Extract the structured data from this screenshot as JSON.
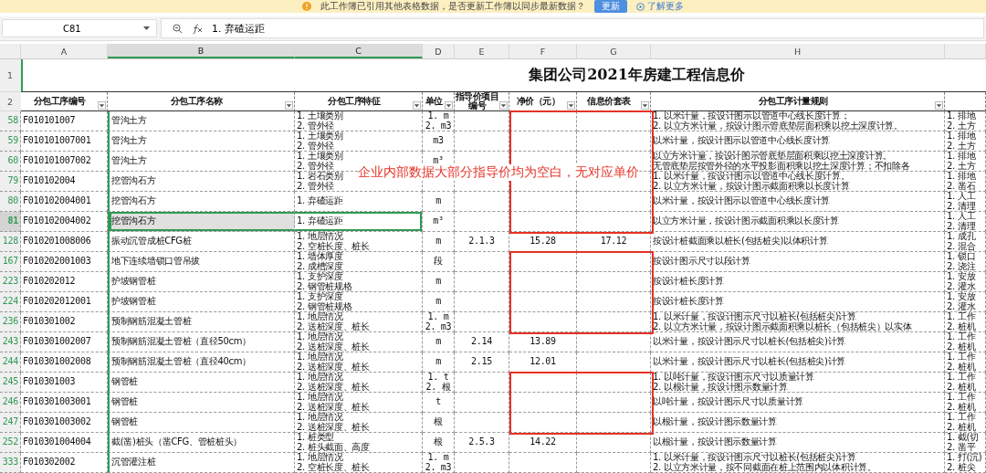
{
  "notification": {
    "message": "此工作簿已引用其他表格数据，是否更新工作簿以同步最新数据？",
    "button": "更新",
    "link": "了解更多"
  },
  "formula_bar": {
    "cell_ref": "C81",
    "formula": "1. 弃碴运距"
  },
  "columns": [
    {
      "label": "A",
      "selected": false
    },
    {
      "label": "B",
      "selected": true
    },
    {
      "label": "C",
      "selected": true
    },
    {
      "label": "D",
      "selected": false
    },
    {
      "label": "E",
      "selected": false
    },
    {
      "label": "F",
      "selected": false
    },
    {
      "label": "G",
      "selected": false
    },
    {
      "label": "H",
      "selected": false
    }
  ],
  "title_row": {
    "row": "1",
    "title": "集团公司2021年房建工程信息价"
  },
  "header_row": {
    "row": "2",
    "headers": [
      "分包工序编号",
      "分包工序名称",
      "分包工序特征",
      "单位",
      "指导价项目编号",
      "净价（元）",
      "信息价套表",
      "分包工序计量规则"
    ]
  },
  "rows": [
    {
      "row": "58",
      "code": "F010101007",
      "name": "管沟土方",
      "features": [
        "1. 土壤类别",
        "2. 管外径"
      ],
      "unit": [
        "1. m",
        "2. m3"
      ],
      "rules": [
        "1. 以米计量，按设计图示以管道中心线长度计算；",
        "2. 以立方米计量，按设计图示管底垫层面积乘以挖土深度计算。"
      ],
      "column_9": [
        "1. 排地",
        "2. 土方"
      ],
      "flagged": true,
      "selected": false
    },
    {
      "row": "59",
      "code": "F010101007001",
      "name": "管沟土方",
      "features": [
        "1. 土壤类别",
        "2. 管外径"
      ],
      "unit": [
        "m3"
      ],
      "rules": [
        "以米计量，按设计图示以管道中心线长度计算"
      ],
      "column_9": [
        "1. 排地",
        "2. 土方"
      ],
      "flagged": true,
      "selected": false
    },
    {
      "row": "60",
      "code": "F010101007002",
      "name": "管沟土方",
      "features": [
        "1. 土壤类别",
        "2. 管外径"
      ],
      "unit": [
        "m³"
      ],
      "rules": [
        "以立方米计量，按设计图示管底垫层面积乘以挖土深度计算。",
        "无管底垫层按管外径的水平投影面积乘以挖土深度计算；不扣除各"
      ],
      "column_9": [
        "1. 排地",
        "2. 土方"
      ],
      "flagged": true,
      "selected": false
    },
    {
      "row": "79",
      "code": "F010102004",
      "name": "挖管沟石方",
      "features": [
        "1. 岩石类别",
        "2. 管外径"
      ],
      "rules": [
        "1. 以米计量，按设计图示以管道中心线长度计算。",
        "2. 以立方米计量，按设计图示截面积乘以长度计算"
      ],
      "column_9": [
        "1. 排地",
        "2. 凿石"
      ],
      "flagged": true,
      "selected": false
    },
    {
      "row": "80",
      "code": "F010102004001",
      "name": "挖管沟石方",
      "features": [
        "1. 弃碴运距"
      ],
      "unit": [
        "m"
      ],
      "rules": [
        "以米计量，按设计图示以管道中心线长度计算"
      ],
      "column_9": [
        "1. 人工",
        "2. 清理"
      ],
      "flagged": true,
      "selected": false
    },
    {
      "row": "81",
      "code": "F010102004002",
      "name": "挖管沟石方",
      "features": [
        "1. 弃碴运距"
      ],
      "unit": [
        "m³"
      ],
      "rules": [
        "以立方米计量，按设计图示截面积乘以长度计算"
      ],
      "column_9": [
        "1. 人工",
        "2. 清理"
      ],
      "flagged": true,
      "selected": true
    },
    {
      "row": "128",
      "code": "F010201008006",
      "name": "振动沉管成桩CFG桩",
      "features": [
        "1. 地层情况",
        "2. 空桩长度、桩长"
      ],
      "unit": [
        "m"
      ],
      "guide_code": "2.1.3",
      "net_price": "15.28",
      "info_price": "17.12",
      "rules": [
        "按设计桩截面乘以桩长(包括桩尖)以体积计算"
      ],
      "column_9": [
        "1. 成孔",
        "2. 混合"
      ],
      "flagged": false,
      "selected": false
    },
    {
      "row": "167",
      "code": "F010202001003",
      "name": "地下连续墙锁口管吊拔",
      "features": [
        "1. 墙体厚度",
        "2. 成槽深度"
      ],
      "unit": [
        "段"
      ],
      "rules": [
        "按设计图示尺寸以段计算"
      ],
      "column_9": [
        "1. 锁口",
        "2. 浇注"
      ],
      "flagged": true,
      "selected": false
    },
    {
      "row": "223",
      "code": "F010202012",
      "name": "护坡钢管桩",
      "features": [
        "1. 支护深度",
        "2. 钢管桩规格"
      ],
      "unit": [
        "m"
      ],
      "rules": [
        "按设计桩长度计算"
      ],
      "column_9": [
        "1. 安放",
        "2. 灌水"
      ],
      "flagged": true,
      "selected": false
    },
    {
      "row": "224",
      "code": "F010202012001",
      "name": "护坡钢管桩",
      "features": [
        "1. 支护深度",
        "2. 钢管桩规格"
      ],
      "unit": [
        "m"
      ],
      "rules": [
        "按设计桩长度计算"
      ],
      "column_9": [
        "1. 安放",
        "2. 灌水"
      ],
      "flagged": true,
      "selected": false
    },
    {
      "row": "236",
      "code": "F010301002",
      "name": "预制钢筋混凝土管桩",
      "features": [
        "1. 地层情况",
        "2. 送桩深度、桩长"
      ],
      "unit": [
        "1. m",
        "2. m3"
      ],
      "rules": [
        "1. 以米计量，按设计图示尺寸以桩长(包括桩尖)计算",
        "2. 以立方米计量，按设计图示截面积乘以桩长（包括桩尖）以实体"
      ],
      "column_9": [
        "1. 工作",
        "2. 桩机"
      ],
      "flagged": true,
      "selected": false
    },
    {
      "row": "243",
      "code": "F010301002007",
      "name": "预制钢筋混凝土管桩（直径50cm）",
      "features": [
        "1. 地层情况",
        "2. 送桩深度、桩长"
      ],
      "unit": [
        "m"
      ],
      "guide_code": "2.14",
      "net_price": "13.89",
      "rules": [
        "以米计量，按设计图示尺寸以桩长(包括桩尖)计算"
      ],
      "column_9": [
        "1. 工作",
        "2. 桩机"
      ],
      "flagged": false,
      "selected": false
    },
    {
      "row": "244",
      "code": "F010301002008",
      "name": "预制钢筋混凝土管桩（直径40cm）",
      "features": [
        "1. 地层情况",
        "2. 送桩深度、桩长"
      ],
      "unit": [
        "m"
      ],
      "guide_code": "2.15",
      "net_price": "12.01",
      "rules": [
        "以米计量，按设计图示尺寸以桩长(包括桩尖)计算"
      ],
      "column_9": [
        "1. 工作",
        "2. 桩机"
      ],
      "flagged": false,
      "selected": false
    },
    {
      "row": "245",
      "code": "F010301003",
      "name": "钢管桩",
      "features": [
        "1. 地层情况",
        "2. 送桩深度、桩长"
      ],
      "unit": [
        "1. t",
        "2. 根"
      ],
      "rules": [
        "1. 以吨计量，按设计图示尺寸以质量计算",
        "2. 以根计量，按设计图示数量计算"
      ],
      "column_9": [
        "1. 工作",
        "2. 桩机"
      ],
      "flagged": true,
      "selected": false
    },
    {
      "row": "246",
      "code": "F010301003001",
      "name": "钢管桩",
      "features": [
        "1. 地层情况",
        "2. 送桩深度、桩长"
      ],
      "unit": [
        "t"
      ],
      "rules": [
        "以吨计量，按设计图示尺寸以质量计算"
      ],
      "column_9": [
        "1. 工作",
        "2. 桩机"
      ],
      "flagged": true,
      "selected": false
    },
    {
      "row": "247",
      "code": "F010301003002",
      "name": "钢管桩",
      "features": [
        "1. 地层情况",
        "2. 送桩深度、桩长"
      ],
      "unit": [
        "根"
      ],
      "rules": [
        "以根计量，按设计图示数量计算"
      ],
      "column_9": [
        "1. 工作",
        "2. 桩机"
      ],
      "flagged": true,
      "selected": false
    },
    {
      "row": "252",
      "code": "F010301004004",
      "name": "截(凿)桩头（凿CFG、管桩桩头）",
      "features": [
        "1. 桩类型",
        "2. 桩头截面、高度"
      ],
      "unit": [
        "根"
      ],
      "guide_code": "2.5.3",
      "net_price": "14.22",
      "rules": [
        "以根计量，按设计图示数量计算"
      ],
      "column_9": [
        "1. 截(切",
        "2. 凿平"
      ],
      "flagged": false,
      "selected": false
    },
    {
      "row": "333",
      "code": "F010302002",
      "name": "沉管灌注桩",
      "features": [
        "1. 地层情况",
        "2. 空桩长度、桩长"
      ],
      "unit": [
        "1. m",
        "2. m3"
      ],
      "rules": [
        "1. 以米计量，按设计图示尺寸以桩长(包括桩尖)计算",
        "2. 以立方米计量，按不同截面在桩上范围内以体积计算。"
      ],
      "column_9": [
        "1. 打(沉)",
        "2. 桩尖"
      ],
      "flagged": false,
      "selected": false
    }
  ],
  "annotation": {
    "text": "企业内部数据大部分指导价均为空白，无对应单价"
  }
}
